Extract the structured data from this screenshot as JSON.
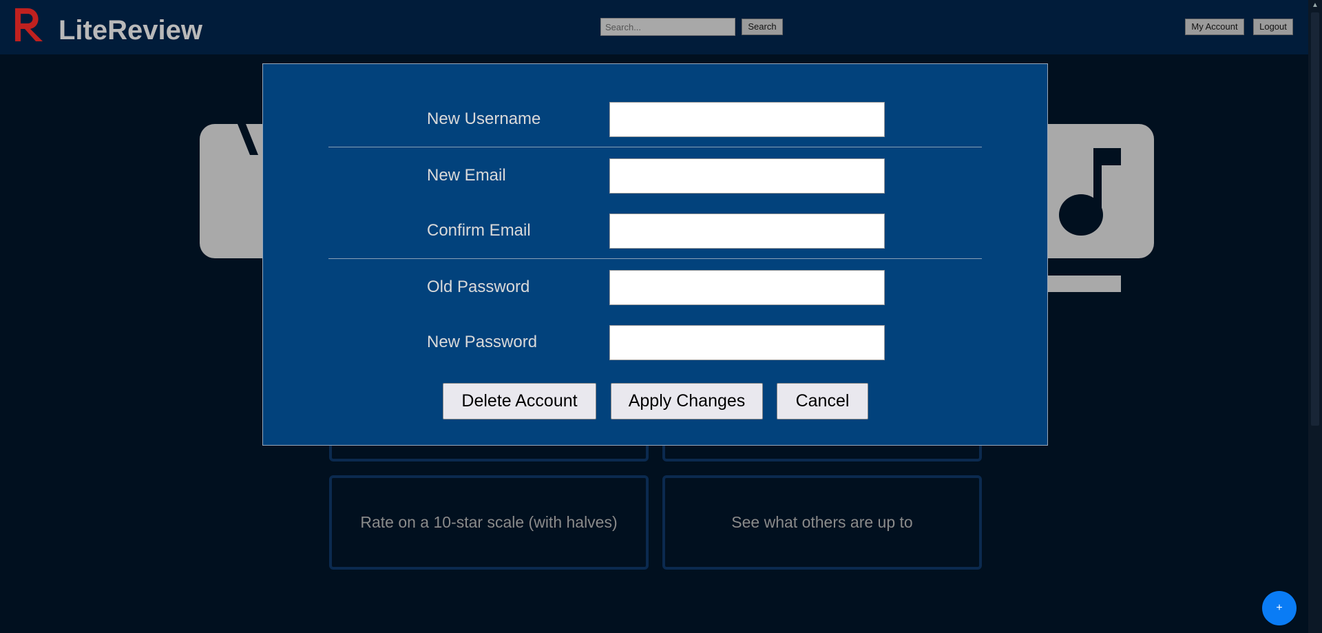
{
  "header": {
    "brand": "LiteReview",
    "search_placeholder": "Search...",
    "search_label": "Search",
    "account_label": "My Account",
    "logout_label": "Logout"
  },
  "colors": {
    "logo": "#c0211f",
    "header_bg": "#011c3a",
    "modal_bg": "#02427c",
    "fab": "#0a7cf5"
  },
  "features": {
    "rate": "Rate on a 10-star scale (with halves)",
    "others": "See what others are up to"
  },
  "fab_label": "+",
  "modal": {
    "fields": {
      "new_username": "New Username",
      "new_email": "New Email",
      "confirm_email": "Confirm Email",
      "old_password": "Old Password",
      "new_password": "New Password"
    },
    "buttons": {
      "delete": "Delete Account",
      "apply": "Apply Changes",
      "cancel": "Cancel"
    }
  },
  "icons": [
    "literview-logo-icon",
    "music-note-icon",
    "scroll-up-arrow-icon"
  ]
}
